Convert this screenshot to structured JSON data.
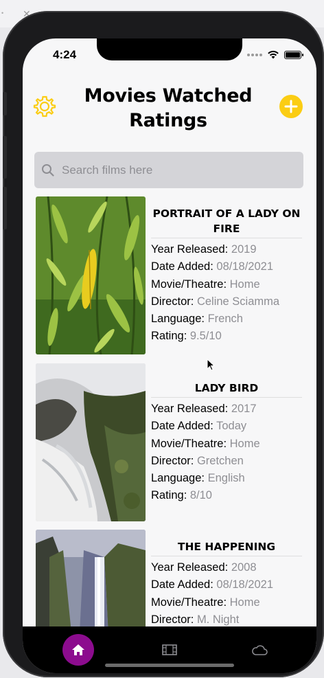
{
  "status": {
    "time": "4:24"
  },
  "header": {
    "title": "Movies Watched Ratings"
  },
  "search": {
    "placeholder": "Search films here",
    "value": ""
  },
  "labels": {
    "year": "Year Released:",
    "added": "Date Added:",
    "venue": "Movie/Theatre:",
    "director": "Director:",
    "language": "Language:",
    "rating": "Rating:"
  },
  "films": [
    {
      "title": "PORTRAIT OF A LADY ON FIRE",
      "year": "2019",
      "added": "08/18/2021",
      "venue": "Home",
      "director": "Celine Sciamma",
      "language": "French",
      "rating": "9.5/10",
      "thumb": "leaves-photo"
    },
    {
      "title": "LADY BIRD",
      "year": "2017",
      "added": "Today",
      "venue": "Home",
      "director": "Gretchen",
      "language": "English",
      "rating": "8/10",
      "thumb": "waterfall-rocks-photo"
    },
    {
      "title": "THE HAPPENING",
      "year": "2008",
      "added": "08/18/2021",
      "venue": "Home",
      "director": "M. Night",
      "thumb": "waterfall-cliff-photo"
    }
  ],
  "tabs": [
    {
      "name": "home",
      "icon": "home-icon",
      "active": true
    },
    {
      "name": "films",
      "icon": "film-icon",
      "active": false
    },
    {
      "name": "cloud",
      "icon": "cloud-icon",
      "active": false
    }
  ],
  "colors": {
    "accent_yellow": "#fbcd14",
    "active_tab": "#8c0c8e",
    "value_gray": "#8e8e93",
    "search_bg": "#d4d4d8"
  }
}
